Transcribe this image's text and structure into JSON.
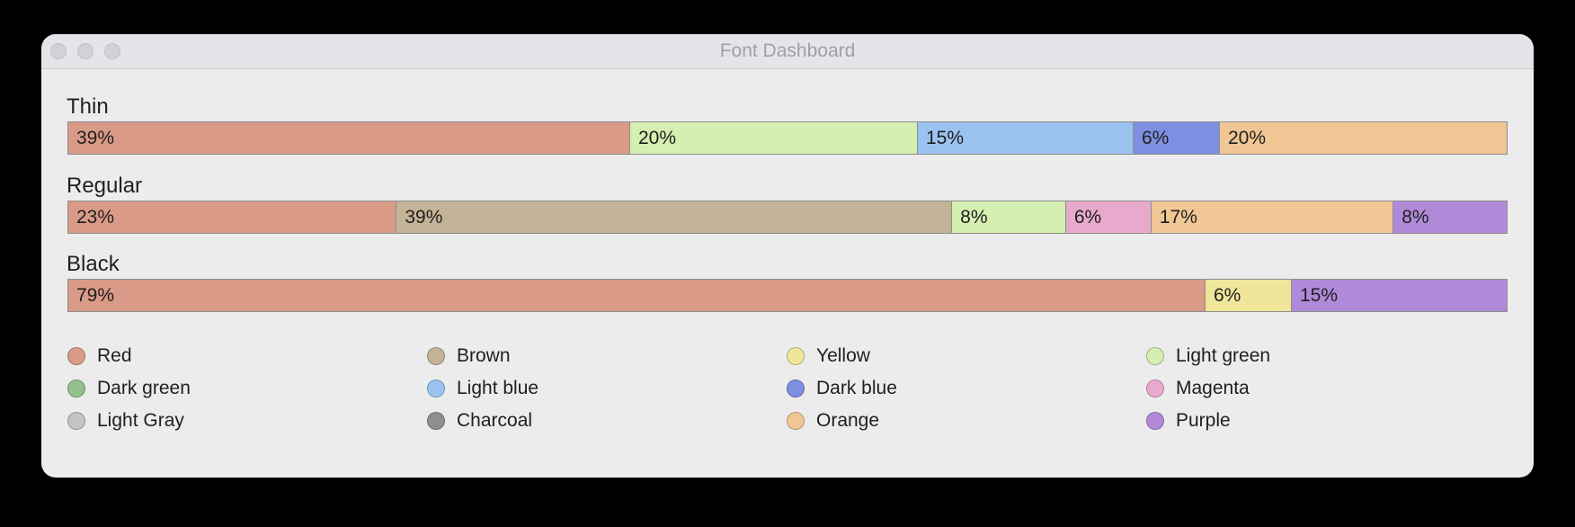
{
  "window": {
    "title": "Font Dashboard"
  },
  "chart_data": {
    "type": "bar",
    "orientation": "horizontal-stacked-100",
    "title": "",
    "groups": [
      {
        "name": "Thin",
        "segments": [
          {
            "series": "Red",
            "value": 39,
            "label": "39%"
          },
          {
            "series": "Light green",
            "value": 20,
            "label": "20%"
          },
          {
            "series": "Light blue",
            "value": 15,
            "label": "15%"
          },
          {
            "series": "Dark blue",
            "value": 6,
            "label": "6%"
          },
          {
            "series": "Orange",
            "value": 20,
            "label": "20%"
          }
        ]
      },
      {
        "name": "Regular",
        "segments": [
          {
            "series": "Red",
            "value": 23,
            "label": "23%"
          },
          {
            "series": "Brown",
            "value": 39,
            "label": "39%"
          },
          {
            "series": "Light green",
            "value": 8,
            "label": "8%"
          },
          {
            "series": "Magenta",
            "value": 6,
            "label": "6%"
          },
          {
            "series": "Orange",
            "value": 17,
            "label": "17%"
          },
          {
            "series": "Purple",
            "value": 8,
            "label": "8%"
          }
        ]
      },
      {
        "name": "Black",
        "segments": [
          {
            "series": "Red",
            "value": 79,
            "label": "79%"
          },
          {
            "series": "Yellow",
            "value": 6,
            "label": "6%"
          },
          {
            "series": "Purple",
            "value": 15,
            "label": "15%"
          }
        ]
      }
    ],
    "legend": {
      "placement": "bottom",
      "items": [
        {
          "name": "Red",
          "color": "#d99a87"
        },
        {
          "name": "Brown",
          "color": "#c4b396"
        },
        {
          "name": "Yellow",
          "color": "#efe69a"
        },
        {
          "name": "Light green",
          "color": "#d4efb0"
        },
        {
          "name": "Dark green",
          "color": "#92c18c"
        },
        {
          "name": "Light blue",
          "color": "#9bc3f0"
        },
        {
          "name": "Dark blue",
          "color": "#7e8fe1"
        },
        {
          "name": "Magenta",
          "color": "#e9a9cd"
        },
        {
          "name": "Light Gray",
          "color": "#c4c4c4"
        },
        {
          "name": "Charcoal",
          "color": "#8f8f8f"
        },
        {
          "name": "Orange",
          "color": "#f0c695"
        },
        {
          "name": "Purple",
          "color": "#b08ad9"
        }
      ]
    }
  }
}
